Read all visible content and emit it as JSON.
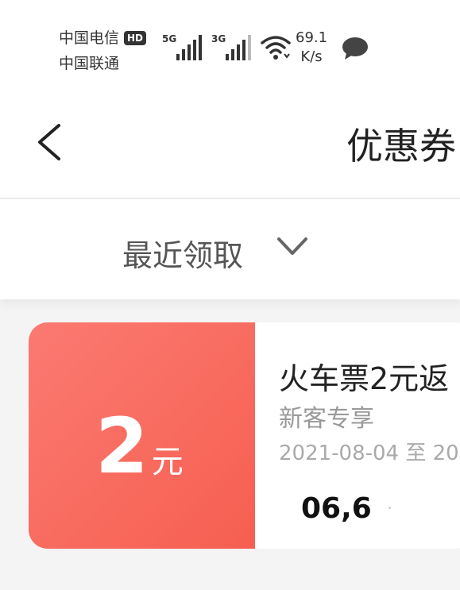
{
  "status_bar": {
    "carrier_1": "中国电信",
    "carrier_1_badge": "HD",
    "carrier_2": "中国联通",
    "signal_1_gen": "5G",
    "signal_2_gen": "3G",
    "speed_value": "69.1",
    "speed_unit": "K/s"
  },
  "header": {
    "title": "优惠券"
  },
  "filter": {
    "label": "最近领取"
  },
  "coupon": {
    "amount": "2",
    "unit": "元",
    "title": "火车票2元返",
    "tag": "新客专享",
    "date": "2021-08-04 至 20",
    "code": "06,6"
  },
  "colors": {
    "coupon_gradient_start": "#fb7a72",
    "coupon_gradient_end": "#f65f50",
    "page_bg": "#f4f4f4"
  }
}
